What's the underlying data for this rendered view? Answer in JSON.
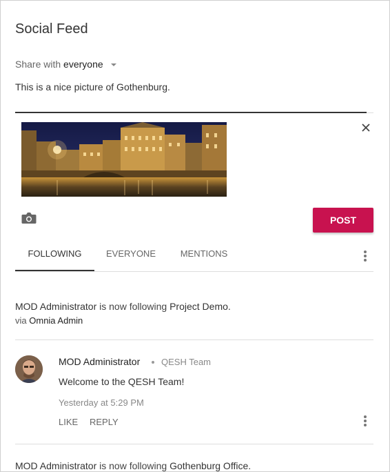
{
  "header": {
    "title": "Social Feed"
  },
  "composer": {
    "share_prefix": "Share with",
    "share_target": "everyone",
    "text": "This is a nice picture of Gothenburg.",
    "post_label": "POST"
  },
  "tabs": [
    {
      "label": "FOLLOWING",
      "active": true
    },
    {
      "label": "EVERYONE",
      "active": false
    },
    {
      "label": "MENTIONS",
      "active": false
    }
  ],
  "feed": [
    {
      "type": "activity",
      "actor": "MOD Administrator",
      "verb": "is now following",
      "object": "Project Demo.",
      "via_prefix": "via",
      "via": "Omnia Admin"
    },
    {
      "type": "post",
      "author": "MOD Administrator",
      "team": "QESH Team",
      "text": "Welcome to the QESH Team!",
      "time": "Yesterday at 5:29 PM",
      "like_label": "LIKE",
      "reply_label": "REPLY"
    },
    {
      "type": "activity",
      "actor": "MOD Administrator",
      "verb": "is now following",
      "object": "Gothenburg Office."
    }
  ],
  "colors": {
    "accent": "#c8124f",
    "text": "#222222",
    "muted": "#888888"
  },
  "icons": [
    "caret-down-icon",
    "close-icon",
    "camera-icon",
    "more-vert-icon"
  ]
}
